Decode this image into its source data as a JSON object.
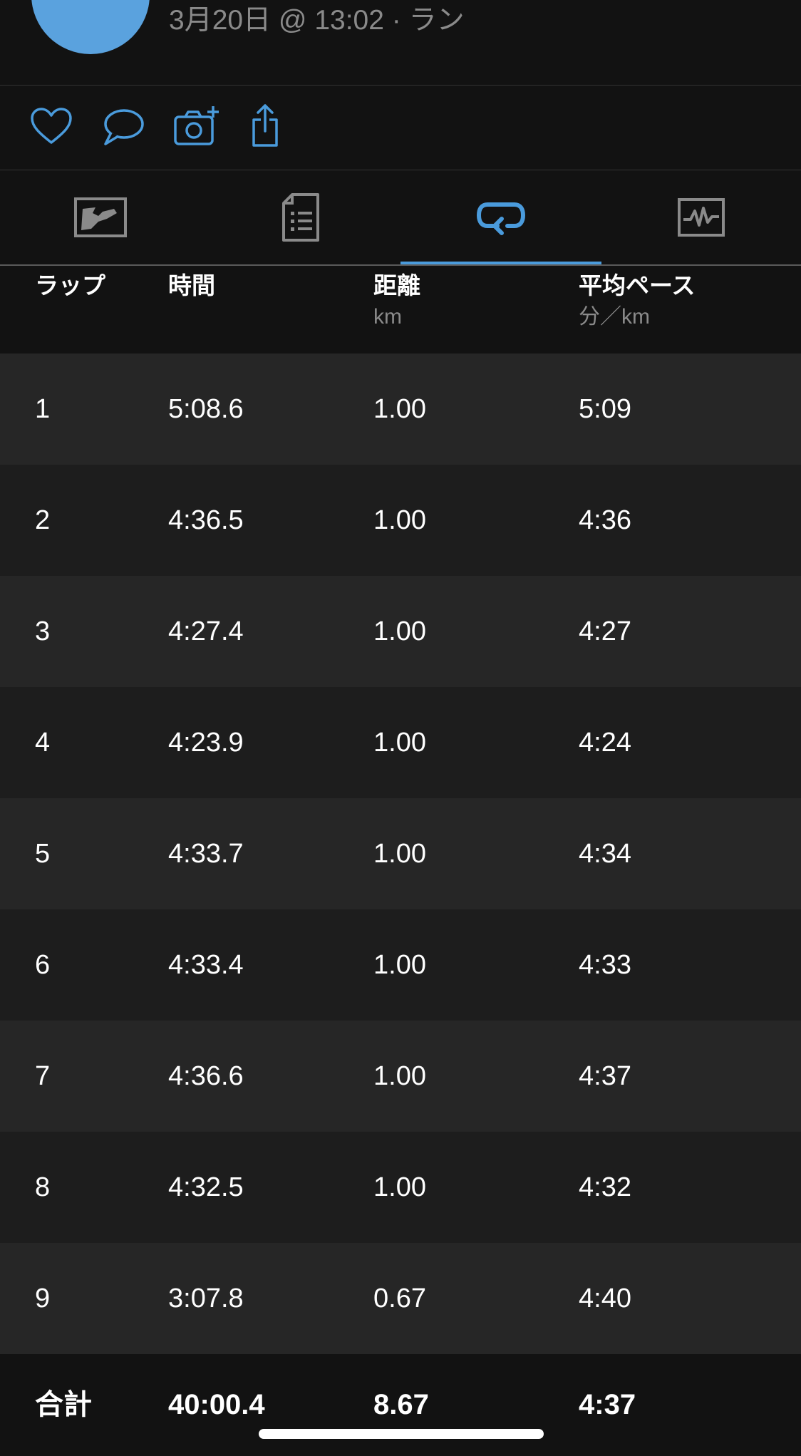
{
  "header": {
    "subtitle": "3月20日 @ 13:02 · ラン"
  },
  "actions": {
    "icons": [
      "heart-icon",
      "comment-icon",
      "add-photo-icon",
      "share-icon"
    ]
  },
  "tabs": {
    "items": [
      "map-tab",
      "summary-tab",
      "laps-tab",
      "charts-tab"
    ],
    "active": "laps-tab",
    "active_color": "#4a9bdc",
    "inactive_color": "#8a8a8a"
  },
  "table": {
    "headers": {
      "lap": "ラップ",
      "time": "時間",
      "distance": "距離",
      "distance_unit": "km",
      "pace": "平均ペース",
      "pace_unit": "分／km"
    },
    "rows": [
      {
        "lap": "1",
        "time": "5:08.6",
        "distance": "1.00",
        "pace": "5:09"
      },
      {
        "lap": "2",
        "time": "4:36.5",
        "distance": "1.00",
        "pace": "4:36"
      },
      {
        "lap": "3",
        "time": "4:27.4",
        "distance": "1.00",
        "pace": "4:27"
      },
      {
        "lap": "4",
        "time": "4:23.9",
        "distance": "1.00",
        "pace": "4:24"
      },
      {
        "lap": "5",
        "time": "4:33.7",
        "distance": "1.00",
        "pace": "4:34"
      },
      {
        "lap": "6",
        "time": "4:33.4",
        "distance": "1.00",
        "pace": "4:33"
      },
      {
        "lap": "7",
        "time": "4:36.6",
        "distance": "1.00",
        "pace": "4:37"
      },
      {
        "lap": "8",
        "time": "4:32.5",
        "distance": "1.00",
        "pace": "4:32"
      },
      {
        "lap": "9",
        "time": "3:07.8",
        "distance": "0.67",
        "pace": "4:40"
      }
    ],
    "total": {
      "label": "合計",
      "time": "40:00.4",
      "distance": "8.67",
      "pace": "4:37"
    }
  },
  "colors": {
    "accent": "#4a9bdc",
    "avatar": "#5aa2de",
    "background": "#121212",
    "row_light": "#262626",
    "row_dark": "#1d1d1d"
  }
}
